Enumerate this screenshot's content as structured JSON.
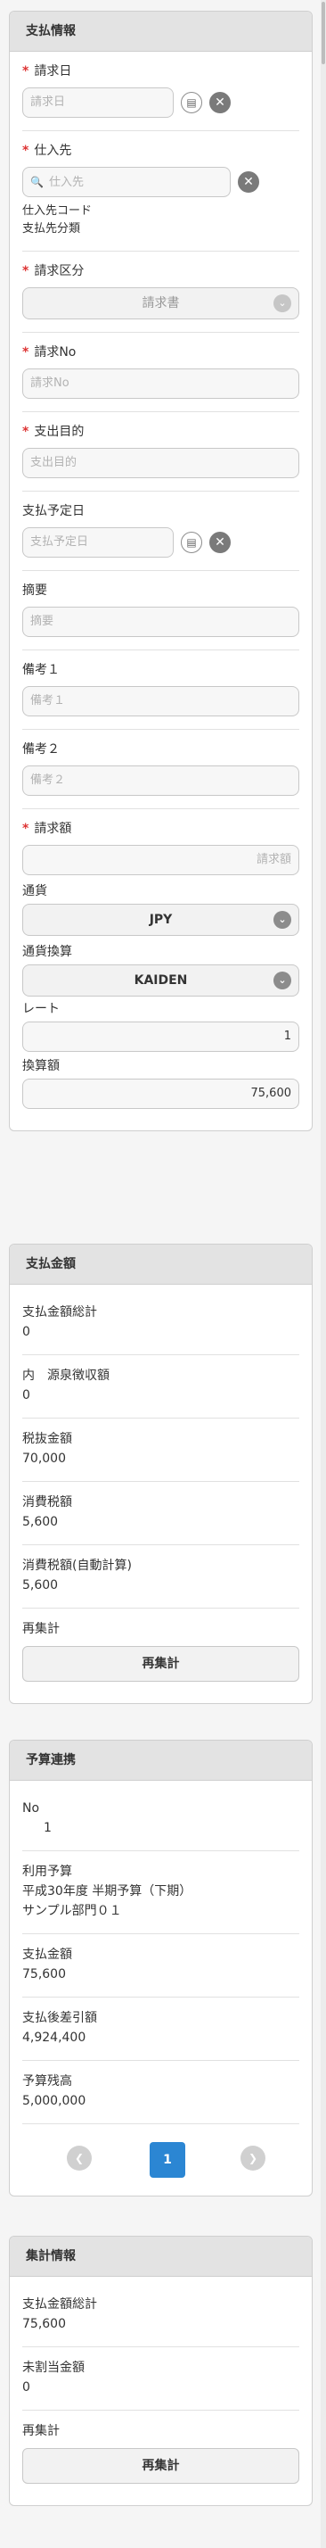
{
  "payment_info": {
    "title": "支払情報",
    "invoice_date": {
      "label": "請求日",
      "placeholder": "請求日"
    },
    "supplier": {
      "label": "仕入先",
      "placeholder": "仕入先",
      "code_label": "仕入先コード",
      "category_label": "支払先分類"
    },
    "invoice_type": {
      "label": "請求区分",
      "value": "請求書"
    },
    "invoice_no": {
      "label": "請求No",
      "placeholder": "請求No"
    },
    "purpose": {
      "label": "支出目的",
      "placeholder": "支出目的"
    },
    "scheduled_date": {
      "label": "支払予定日",
      "placeholder": "支払予定日"
    },
    "summary": {
      "label": "摘要",
      "placeholder": "摘要"
    },
    "note1": {
      "label": "備考１",
      "placeholder": "備考１"
    },
    "note2": {
      "label": "備考２",
      "placeholder": "備考２"
    },
    "invoice_amount": {
      "label": "請求額",
      "placeholder": "請求額"
    },
    "currency": {
      "label": "通貨",
      "value": "JPY"
    },
    "conversion": {
      "label": "通貨換算",
      "value": "KAIDEN"
    },
    "rate": {
      "label": "レート",
      "value": "1"
    },
    "converted": {
      "label": "換算額",
      "value": "75,600"
    }
  },
  "payment_amount": {
    "title": "支払金額",
    "rows": [
      {
        "label": "支払金額総計",
        "value": "0"
      },
      {
        "label": "内　源泉徴収額",
        "value": "0"
      },
      {
        "label": "税抜金額",
        "value": "70,000"
      },
      {
        "label": "消費税額",
        "value": "5,600"
      },
      {
        "label": "消費税額(自動計算)",
        "value": "5,600"
      }
    ],
    "recalc_label": "再集計",
    "recalc_button": "再集計"
  },
  "budget": {
    "title": "予算連携",
    "no_label": "No",
    "no_value": "1",
    "budget_label": "利用予算",
    "budget_line1": "平成30年度 半期予算（下期）",
    "budget_line2": "サンプル部門０１",
    "rows": [
      {
        "label": "支払金額",
        "value": "75,600"
      },
      {
        "label": "支払後差引額",
        "value": "4,924,400"
      },
      {
        "label": "予算残高",
        "value": "5,000,000"
      }
    ],
    "page": "1"
  },
  "totals": {
    "title": "集計情報",
    "rows": [
      {
        "label": "支払金額総計",
        "value": "75,600"
      },
      {
        "label": "未割当金額",
        "value": "0"
      }
    ],
    "recalc_label": "再集計",
    "recalc_button": "再集計"
  },
  "icons": {
    "required": "*",
    "calendar": "▤",
    "clear": "✕",
    "search": "🔍",
    "chevron": "⌄",
    "prev": "❮",
    "next": "❯"
  }
}
